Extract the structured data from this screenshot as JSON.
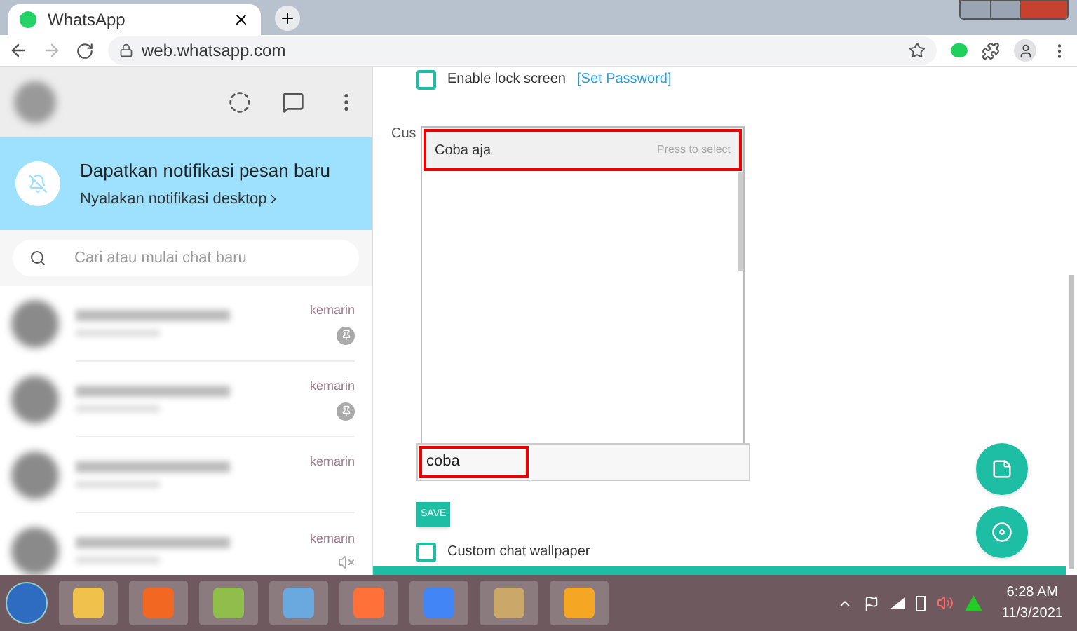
{
  "browser": {
    "tab_title": "WhatsApp",
    "url": "web.whatsapp.com"
  },
  "sidebar": {
    "banner_title": "Dapatkan notifikasi pesan baru",
    "banner_link": "Nyalakan notifikasi desktop",
    "search_placeholder": "Cari atau mulai chat baru",
    "chats": [
      {
        "time": "kemarin",
        "kind": "pinned"
      },
      {
        "time": "kemarin",
        "kind": "pinned"
      },
      {
        "time": "kemarin",
        "kind": "plain"
      },
      {
        "time": "kemarin",
        "kind": "muted"
      }
    ]
  },
  "settings": {
    "lock_screen": {
      "label": "Enable lock screen",
      "link": "[Set Password]",
      "checked": false
    },
    "custom_label": "Cus",
    "suggestion": {
      "text": "Coba aja",
      "hint": "Press to select"
    },
    "input_value": "coba",
    "save": "SAVE",
    "wallpaper": {
      "label": "Custom chat wallpaper",
      "checked": false
    }
  },
  "taskbar": {
    "time": "6:28 AM",
    "date": "11/3/2021"
  }
}
